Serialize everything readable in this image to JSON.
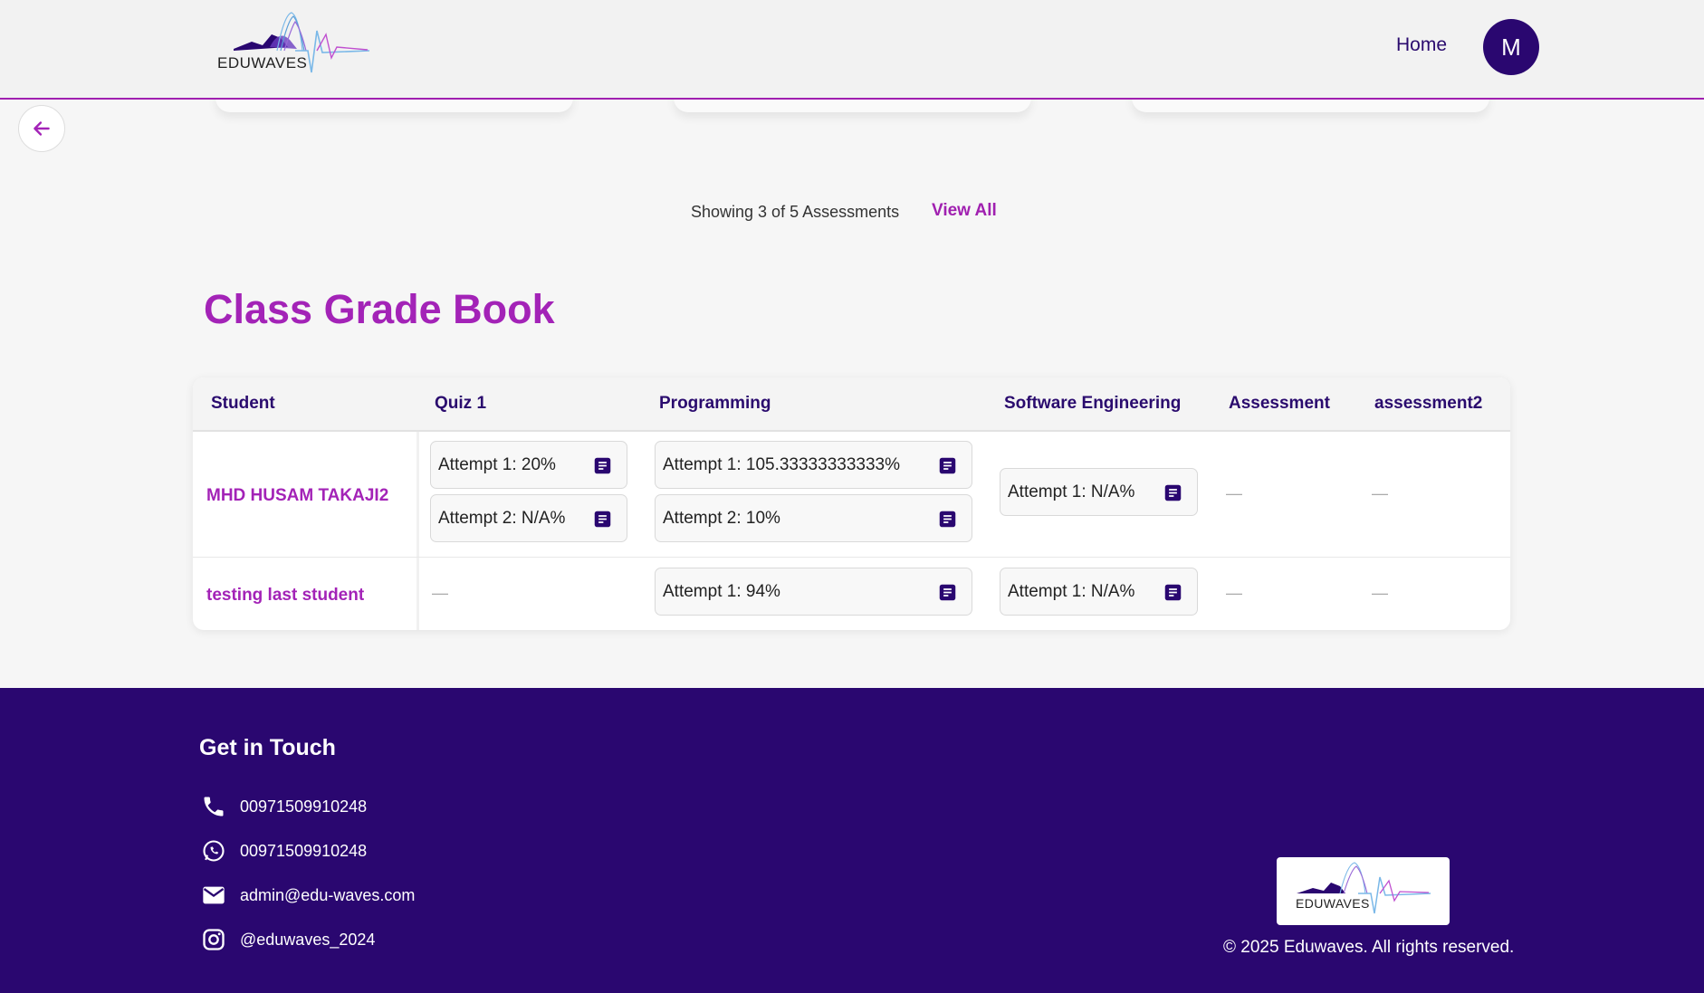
{
  "header": {
    "logo_text": "EDUWAVES",
    "nav_home": "Home",
    "avatar_initial": "M"
  },
  "assessments": {
    "showing_text": "Showing 3 of 5 Assessments",
    "view_all": "View All"
  },
  "gradebook": {
    "title": "Class Grade Book",
    "columns": [
      "Student",
      "Quiz 1",
      "Programming",
      "Software Engineering",
      "Assessment",
      "assessment2"
    ],
    "rows": [
      {
        "student": "MHD HUSAM TAKAJI2",
        "quiz1": [
          "Attempt 1: 20%",
          "Attempt 2: N/A%"
        ],
        "programming": [
          "Attempt 1: 105.33333333333%",
          "Attempt 2: 10%"
        ],
        "software_engineering": [
          "Attempt 1: N/A%"
        ],
        "assessment": "—",
        "assessment2": "—"
      },
      {
        "student": "testing last student",
        "quiz1": "—",
        "programming": [
          "Attempt 1: 94%"
        ],
        "software_engineering": [
          "Attempt 1: N/A%"
        ],
        "assessment": "—",
        "assessment2": "—"
      }
    ]
  },
  "footer": {
    "title": "Get in Touch",
    "phone": "00971509910248",
    "whatsapp": "00971509910248",
    "email": "admin@edu-waves.com",
    "instagram": "@eduwaves_2024",
    "logo_text": "EDUWAVES",
    "copyright": "© 2025 Eduwaves. All rights reserved."
  },
  "colors": {
    "brand_purple": "#a323b7",
    "brand_navy": "#2a0770",
    "header_border": "#a020b0"
  },
  "icons": {
    "back": "arrow-left-icon",
    "grade_detail": "document-icon",
    "phone": "phone-icon",
    "whatsapp": "whatsapp-icon",
    "email": "mail-icon",
    "instagram": "instagram-icon"
  }
}
